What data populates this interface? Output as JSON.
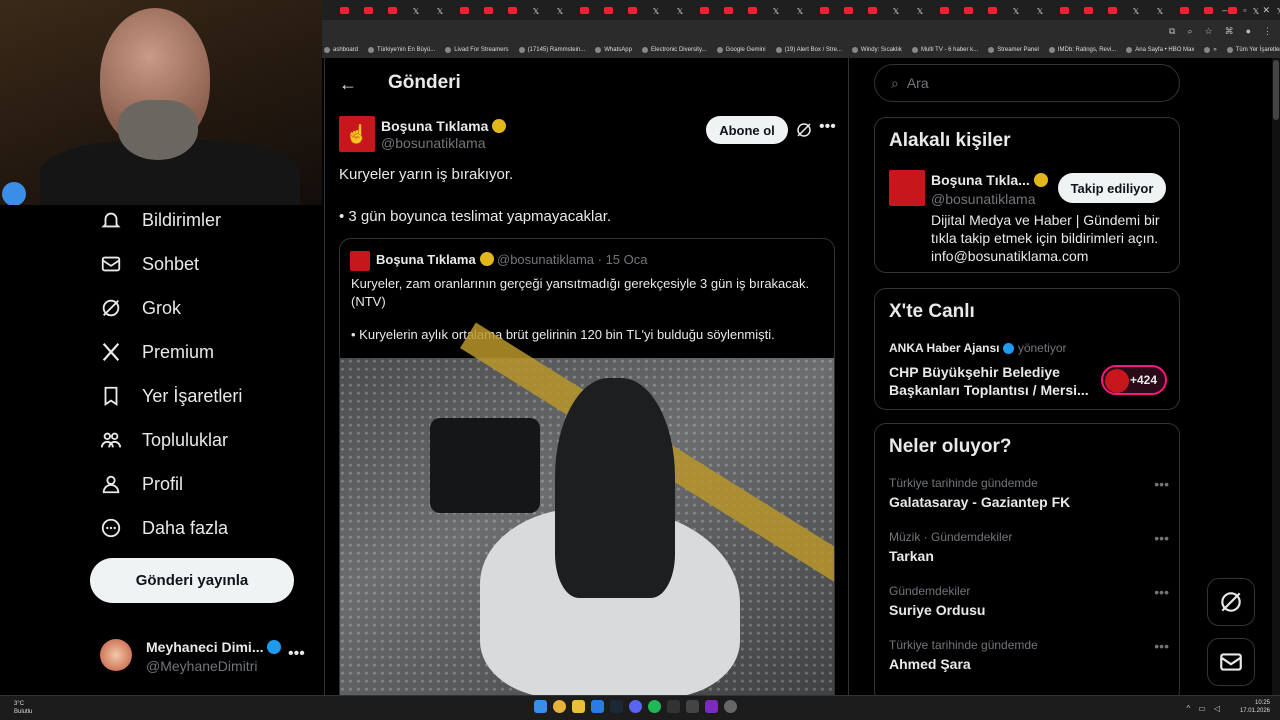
{
  "browser": {
    "tab_count": 44,
    "window_controls": [
      "–",
      "▫",
      "✕"
    ],
    "new_tab": "+",
    "bookmarks": [
      "ashboard",
      "Türkiye'nin En Büyü...",
      "Livad For Streamers",
      "(17145) Rammstein...",
      "WhatsApp",
      "Electronic Diversity...",
      "Google Gemini",
      "(19) Alert Box / Stre...",
      "Windy: Sıcaklık",
      "Multi TV - 6 haber k...",
      "Streamer Panel",
      "IMDb: Ratings, Revi...",
      "Ana Sayfa • HBO Max",
      "»",
      "Tüm Yer İşaretleri"
    ]
  },
  "nav": {
    "items": [
      {
        "label": "Bildirimler",
        "icon": "bell-icon"
      },
      {
        "label": "Sohbet",
        "icon": "mail-icon"
      },
      {
        "label": "Grok",
        "icon": "grok-icon"
      },
      {
        "label": "Premium",
        "icon": "x-logo-icon"
      },
      {
        "label": "Yer İşaretleri",
        "icon": "bookmark-icon"
      },
      {
        "label": "Topluluklar",
        "icon": "people-icon"
      },
      {
        "label": "Profil",
        "icon": "person-icon"
      },
      {
        "label": "Daha fazla",
        "icon": "more-circle-icon"
      }
    ],
    "post_button": "Gönderi yayınla",
    "account": {
      "name": "Meyhaneci Dimi...",
      "handle": "@MeyhaneDimitri",
      "more": "•••"
    }
  },
  "post": {
    "header_title": "Gönderi",
    "author_name": "Boşuna Tıklama",
    "author_handle": "@bosunatiklama",
    "subscribe_button": "Abone ol",
    "more": "•••",
    "text_line1": "Kuryeler yarın iş bırakıyor.",
    "text_line2": "• 3 gün boyunca teslimat yapmayacaklar.",
    "quote": {
      "name": "Boşuna Tıklama",
      "handle_date": "@bosunatiklama · 15 Oca",
      "text1": "Kuryeler, zam oranlarının gerçeği yansıtmadığı gerekçesiyle 3 gün iş bırakacak. (NTV)",
      "text2": "• Kuryelerin aylık ortalama brüt gelirinin 120 bin TL'yi bulduğu söylenmişti."
    }
  },
  "right": {
    "search_placeholder": "Ara",
    "related": {
      "title": "Alakalı kişiler",
      "name": "Boşuna Tıkla...",
      "handle": "@bosunatiklama",
      "follow_button": "Takip ediliyor",
      "bio": "Dijital Medya ve Haber | Gündemi bir tıkla takip etmek için bildirimleri açın. info@bosunatiklama.com"
    },
    "live": {
      "title": "X'te Canlı",
      "source": "ANKA Haber Ajansı",
      "source_suffix": "yönetiyor",
      "stream_title": "CHP Büyükşehir Belediye Başkanları Toplantısı / Mersi...",
      "count": "+424"
    },
    "trends": {
      "title": "Neler oluyor?",
      "items": [
        {
          "context": "Türkiye tarihinde gündemde",
          "topic": "Galatasaray - Gaziantep FK"
        },
        {
          "context": "Müzik · Gündemdekiler",
          "topic": "Tarkan"
        },
        {
          "context": "Gündemdekiler",
          "topic": "Suriye Ordusu"
        },
        {
          "context": "Türkiye tarihinde gündemde",
          "topic": "Ahmed Şara"
        }
      ],
      "more": "•••"
    }
  },
  "taskbar": {
    "weather_temp": "3°C",
    "weather_desc": "Bulutlu",
    "time": "10:25",
    "date": "17.01.2026"
  },
  "colors": {
    "brand_red": "#c8161d",
    "verified_gold": "#e2b719",
    "verified_blue": "#1d9bf0",
    "live_pink": "#f91880"
  }
}
